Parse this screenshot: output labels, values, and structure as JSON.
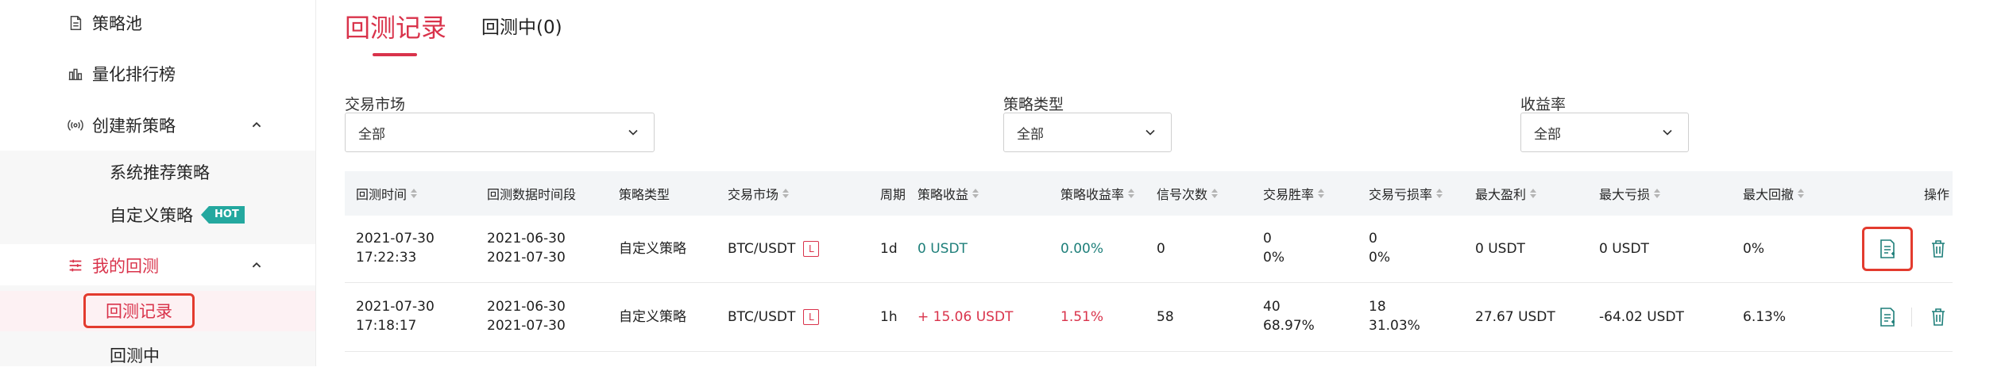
{
  "sidebar": {
    "strategy_pool": "策略池",
    "ranking": "量化排行榜",
    "create_strategy": "创建新策略",
    "system_recommend": "系统推荐策略",
    "custom_strategy": "自定义策略",
    "hot_badge": "HOT",
    "my_backtest": "我的回测",
    "backtest_records": "回测记录",
    "backtesting": "回测中"
  },
  "tabs": {
    "records": "回测记录",
    "in_progress": "回测中(0)"
  },
  "filters": {
    "market_label": "交易市场",
    "market_value": "全部",
    "type_label": "策略类型",
    "type_value": "全部",
    "yield_label": "收益率",
    "yield_value": "全部"
  },
  "table": {
    "headers": {
      "time": "回测时间",
      "period_range": "回测数据时间段",
      "type": "策略类型",
      "market": "交易市场",
      "cycle": "周期",
      "profit": "策略收益",
      "profit_rate": "策略收益率",
      "signals": "信号次数",
      "win_rate": "交易胜率",
      "loss_rate": "交易亏损率",
      "max_profit": "最大盈利",
      "max_loss": "最大亏损",
      "max_drawdown": "最大回撤",
      "actions": "操作"
    },
    "rows": [
      {
        "time_date": "2021-07-30",
        "time_clock": "17:22:33",
        "range_start": "2021-06-30",
        "range_end": "2021-07-30",
        "type": "自定义策略",
        "market": "BTC/USDT",
        "badge": "L",
        "cycle": "1d",
        "profit": "0 USDT",
        "profit_rate": "0.00%",
        "signals": "0",
        "win_count": "0",
        "win_rate": "0%",
        "loss_count": "0",
        "loss_rate": "0%",
        "max_profit": "0 USDT",
        "max_loss": "0 USDT",
        "max_drawdown": "0%"
      },
      {
        "time_date": "2021-07-30",
        "time_clock": "17:18:17",
        "range_start": "2021-06-30",
        "range_end": "2021-07-30",
        "type": "自定义策略",
        "market": "BTC/USDT",
        "badge": "L",
        "cycle": "1h",
        "profit": "+ 15.06 USDT",
        "profit_rate": "1.51%",
        "signals": "58",
        "win_count": "40",
        "win_rate": "68.97%",
        "loss_count": "18",
        "loss_rate": "31.03%",
        "max_profit": "27.67 USDT",
        "max_loss": "-64.02 USDT",
        "max_drawdown": "6.13%"
      }
    ]
  },
  "colors": {
    "accent_red": "#d9334b",
    "highlight_red": "#e33b2e",
    "teal": "#1e7f7a",
    "hot_teal": "#24a89f"
  },
  "icons": [
    "document-icon",
    "bar-chart-icon",
    "broadcast-icon",
    "chevron-up-icon",
    "sliders-icon",
    "chevron-down-icon",
    "report-icon",
    "trash-icon"
  ]
}
